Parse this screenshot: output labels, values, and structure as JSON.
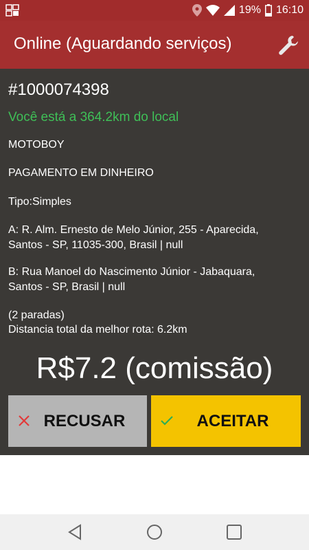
{
  "status_bar": {
    "battery": "19%",
    "time": "16:10"
  },
  "app_bar": {
    "title": "Online (Aguardando serviços)"
  },
  "order": {
    "id": "#1000074398",
    "distance_text": "Você está a 364.2km do local",
    "vehicle": "MOTOBOY",
    "payment": "PAGAMENTO EM DINHEIRO",
    "type": "Tipo:Simples",
    "address_a_line1": "A: R. Alm. Ernesto de Melo Júnior, 255 - Aparecida,",
    "address_a_line2": "Santos - SP, 11035-300, Brasil | null",
    "address_b_line1": "B: Rua Manoel do Nascimento Júnior - Jabaquara,",
    "address_b_line2": "Santos - SP, Brasil | null",
    "stops": "(2 paradas)",
    "route_total": "Distancia total da melhor rota: 6.2km",
    "commission": "R$7.2 (comissão)"
  },
  "actions": {
    "refuse_label": "RECUSAR",
    "accept_label": "ACEITAR"
  },
  "colors": {
    "app_bar": "#a42f2f",
    "panel": "#3b3936",
    "distance_green": "#3fbf57",
    "accept": "#f4c300",
    "refuse": "#b5b5b5"
  }
}
